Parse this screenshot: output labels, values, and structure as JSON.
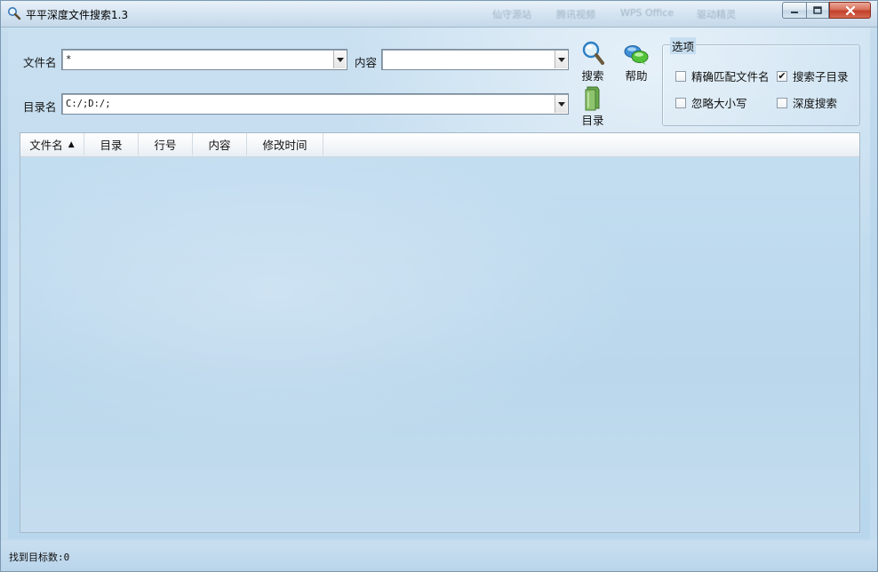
{
  "window": {
    "title": "平平深度文件搜索1.3",
    "faded_taskbar_hints": [
      "仙守源站",
      "腾讯视频",
      "WPS Office",
      "驱动精灵"
    ]
  },
  "search": {
    "filename_label": "文件名",
    "filename_value": "*",
    "content_label": "内容",
    "content_value": "",
    "directory_label": "目录名",
    "directory_value": "C:/;D:/;"
  },
  "toolbar": {
    "search_label": "搜索",
    "help_label": "帮助",
    "directory_label": "目录"
  },
  "options": {
    "title": "选项",
    "exact_match_label": "精确匹配文件名",
    "exact_match_checked": false,
    "subdirs_label": "搜索子目录",
    "subdirs_checked": true,
    "ignore_case_label": "忽略大小写",
    "ignore_case_checked": false,
    "deep_search_label": "深度搜索",
    "deep_search_checked": false
  },
  "results": {
    "columns": [
      "文件名",
      "目录",
      "行号",
      "内容",
      "修改时间"
    ],
    "sort_indicator": "▲"
  },
  "status": {
    "text": "找到目标数:0"
  },
  "icons": [
    "app-search-icon",
    "magnifier-icon",
    "chat-bubbles-icon",
    "green-folder-icon",
    "minimize-icon",
    "maximize-icon",
    "close-icon",
    "checkmark-icon",
    "dropdown-arrow-icon"
  ],
  "colors": {
    "background": "#bcd6e9",
    "close_button": "#c2402a"
  }
}
